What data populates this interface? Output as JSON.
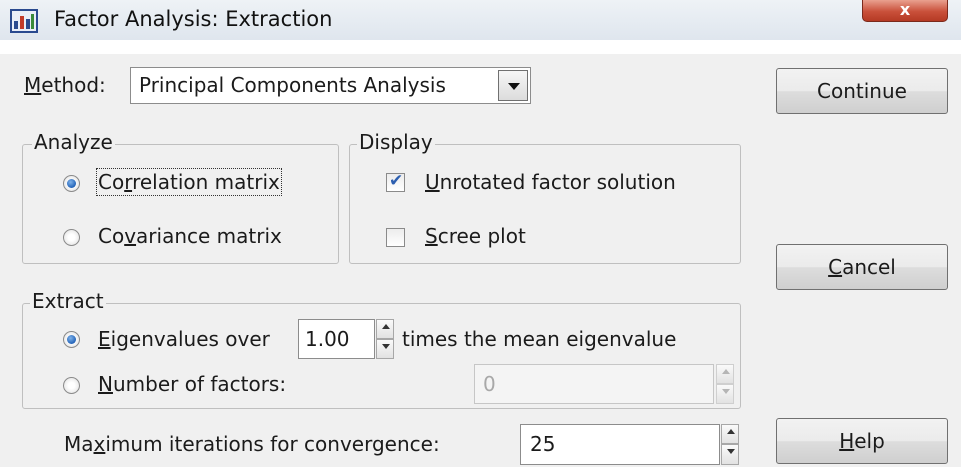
{
  "window": {
    "title": "Factor Analysis: Extraction",
    "close_label": "x"
  },
  "method": {
    "label_prefix": "",
    "label_accel": "M",
    "label_rest": "ethod:",
    "value": "Principal Components Analysis"
  },
  "analyze": {
    "legend": "Analyze",
    "correlation": {
      "pre": "Co",
      "accel": "r",
      "post": "relation matrix",
      "checked": true
    },
    "covariance": {
      "pre": "Co",
      "accel": "v",
      "post": "ariance matrix",
      "checked": false
    }
  },
  "display": {
    "legend": "Display",
    "unrotated": {
      "pre": "",
      "accel": "U",
      "post": "nrotated factor solution",
      "checked": true
    },
    "scree": {
      "pre": "",
      "accel": "S",
      "post": "cree plot",
      "checked": false
    }
  },
  "extract": {
    "legend": "Extract",
    "eigen": {
      "pre": "",
      "accel": "E",
      "post": "igenvalues over",
      "value": "1.00",
      "suffix": "times the mean eigenvalue",
      "checked": true
    },
    "nfactors": {
      "pre": "",
      "accel": "N",
      "post": "umber of factors:",
      "value": "0",
      "checked": false
    }
  },
  "iterations": {
    "pre": "Ma",
    "accel": "x",
    "post": "imum iterations for convergence:",
    "value": "25"
  },
  "buttons": {
    "continue": {
      "pre": "Continue",
      "accel": "",
      "post": ""
    },
    "cancel": {
      "pre": "",
      "accel": "C",
      "post": "ancel"
    },
    "help": {
      "pre": "",
      "accel": "H",
      "post": "elp"
    }
  },
  "colors": {
    "dialog_bg": "#f0f0f0",
    "radio_dot": "#2363b8",
    "check_mark": "#2d5fb0",
    "close_button": "#c9503a"
  }
}
